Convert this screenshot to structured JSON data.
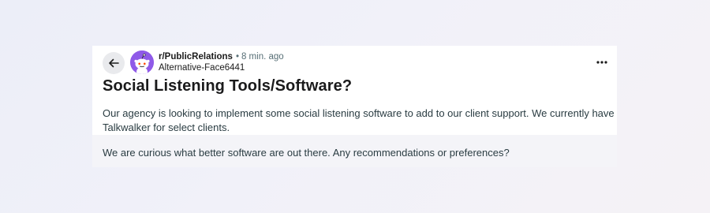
{
  "post": {
    "subreddit": "r/PublicRelations",
    "separator": "•",
    "time_ago": "8 min. ago",
    "author": "Alternative-Face6441",
    "title": "Social Listening Tools/Software?",
    "paragraphs": [
      "Our agency is looking to implement some social listening software to add to our client support. We currently have Talkwalker for select clients.",
      "We are curious what better software are out there. Any recommendations or preferences?"
    ]
  },
  "icons": {
    "back": "arrow-left-icon",
    "avatar": "snoo-avatar-icon",
    "more": "more-horizontal-icon"
  },
  "colors": {
    "avatar_bg": "#8f5ae8",
    "card_bg": "#ffffff",
    "back_button_bg": "#e9eaed"
  }
}
